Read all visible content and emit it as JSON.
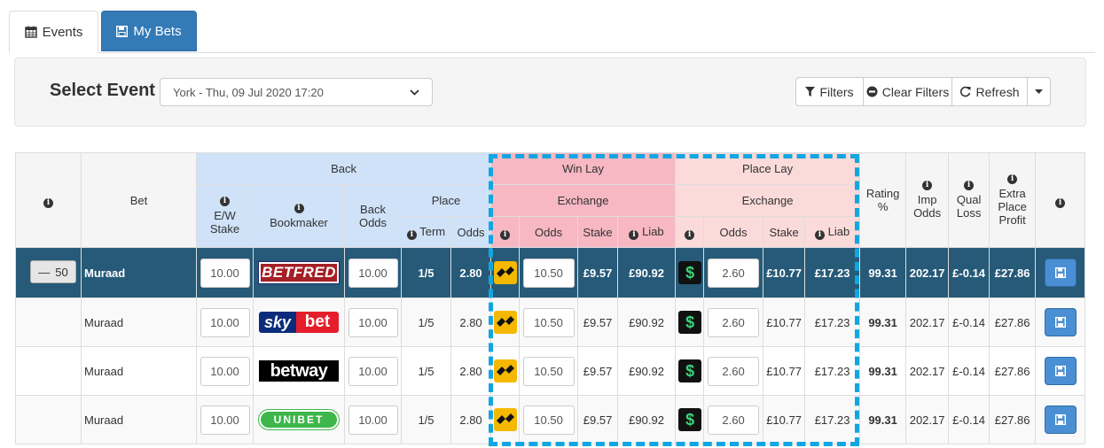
{
  "tabs": {
    "events": "Events",
    "my_bets": "My Bets"
  },
  "panel": {
    "label": "Select Event",
    "selected_event": "York - Thu, 09 Jul 2020 17:20",
    "buttons": {
      "filters": "Filters",
      "clear_filters": "Clear Filters",
      "refresh": "Refresh"
    }
  },
  "table": {
    "groups": {
      "back": "Back",
      "win_lay": "Win Lay",
      "place_lay": "Place Lay",
      "win_exchange": "Exchange",
      "place_exchange": "Exchange",
      "place": "Place"
    },
    "headers": {
      "bet": "Bet",
      "ew_stake": "E/W Stake",
      "bookmaker": "Bookmaker",
      "back_odds": "Back Odds",
      "term": "Term",
      "odds": "Odds",
      "win_odds": "Odds",
      "win_stake": "Stake",
      "win_liab": "Liab",
      "place_odds": "Odds",
      "place_stake": "Stake",
      "place_liab": "Liab",
      "rating": "Rating %",
      "imp_odds": "Imp Odds",
      "qual_loss": "Qual Loss",
      "extra_place_profit": "Extra Place Profit"
    },
    "group_row": {
      "collapse_count": "50",
      "name": "Muraad",
      "ew_stake": "10.00",
      "bookmaker": "BETFRED",
      "back_odds": "10.00",
      "term": "1/5",
      "place_odds": "2.80",
      "win_lay_odds": "10.50",
      "win_stake": "£9.57",
      "win_liab": "£90.92",
      "place_lay_odds": "2.60",
      "place_stake": "£10.77",
      "place_liab": "£17.23",
      "rating": "99.31",
      "imp_odds": "202.17",
      "qual_loss": "£-0.14",
      "extra_place_profit": "£27.86"
    },
    "rows": [
      {
        "name": "Muraad",
        "ew_stake": "10.00",
        "bookmaker": "skybet",
        "bookmaker_sky": "sky",
        "bookmaker_bet": "bet",
        "back_odds": "10.00",
        "term": "1/5",
        "place_odds": "2.80",
        "win_lay_odds": "10.50",
        "win_stake": "£9.57",
        "win_liab": "£90.92",
        "place_lay_odds": "2.60",
        "place_stake": "£10.77",
        "place_liab": "£17.23",
        "rating": "99.31",
        "imp_odds": "202.17",
        "qual_loss": "£-0.14",
        "extra_place_profit": "£27.86"
      },
      {
        "name": "Muraad",
        "ew_stake": "10.00",
        "bookmaker": "betway",
        "back_odds": "10.00",
        "term": "1/5",
        "place_odds": "2.80",
        "win_lay_odds": "10.50",
        "win_stake": "£9.57",
        "win_liab": "£90.92",
        "place_lay_odds": "2.60",
        "place_stake": "£10.77",
        "place_liab": "£17.23",
        "rating": "99.31",
        "imp_odds": "202.17",
        "qual_loss": "£-0.14",
        "extra_place_profit": "£27.86"
      },
      {
        "name": "Muraad",
        "ew_stake": "10.00",
        "bookmaker": "UNIBET",
        "back_odds": "10.00",
        "term": "1/5",
        "place_odds": "2.80",
        "win_lay_odds": "10.50",
        "win_stake": "£9.57",
        "win_liab": "£90.92",
        "place_lay_odds": "2.60",
        "place_stake": "£10.77",
        "place_liab": "£17.23",
        "rating": "99.31",
        "imp_odds": "202.17",
        "qual_loss": "£-0.14",
        "extra_place_profit": "£27.86"
      }
    ]
  },
  "colors": {
    "primary": "#337ab7",
    "group_row": "#265a78",
    "back_header": "#cfe2f8",
    "win_lay_header": "#f7b7c3",
    "place_lay_header": "#fbdada",
    "highlight_dash": "#12a6e0",
    "save_button": "#4a8fd4"
  },
  "icons": {
    "events_tab": "calendar-icon",
    "my_bets_tab": "floppy-disk-icon",
    "filters": "filter-icon",
    "clear_filters": "minus-circle-icon",
    "refresh": "refresh-icon",
    "caret": "caret-down-icon",
    "info": "info-icon",
    "save": "floppy-disk-icon",
    "win_exchange": "betfair-exchange-icon",
    "place_exchange": "smarkets-exchange-icon"
  }
}
